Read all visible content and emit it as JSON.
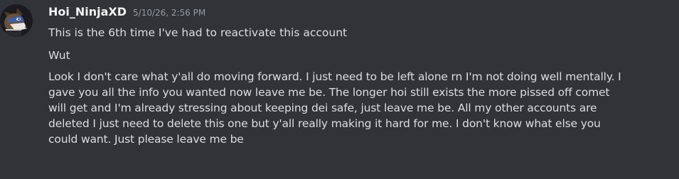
{
  "author": {
    "username": "Hoi_NinjaXD",
    "timestamp": "5/10/26, 2:56 PM",
    "avatar_icon": "fox-avatar-icon"
  },
  "messages": [
    {
      "text": "This is the 6th time I've had to reactivate this account"
    },
    {
      "text": "Wut"
    },
    {
      "lines": [
        "Look I don't care what y'all do moving forward. I just need to be left alone rn I'm not doing well mentally. I",
        "gave you all the info you wanted now leave me be. The longer hoi still exists the more pissed off comet",
        "will get and I'm already stressing about keeping dei safe, just leave me be. All my other accounts are",
        "deleted I just need to delete this one but y'all really making it hard for me. I don't know what else you",
        "could want. Just please leave me be"
      ]
    }
  ],
  "colors": {
    "background": "#323339",
    "username": "#f2f3f5",
    "timestamp": "#949ba4",
    "message_text": "#dbdee1"
  }
}
